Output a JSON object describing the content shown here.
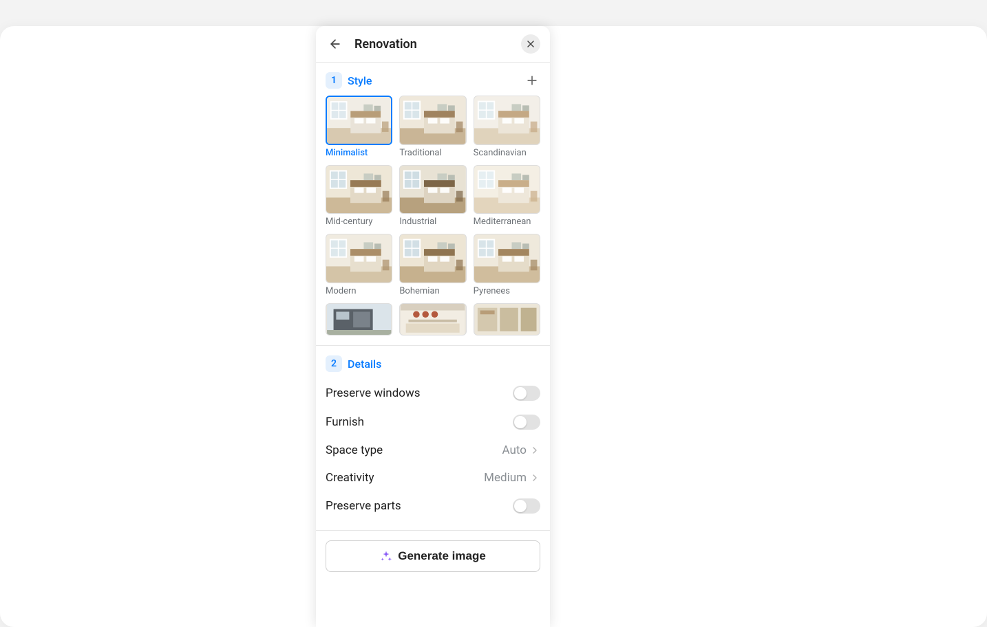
{
  "header": {
    "title": "Renovation"
  },
  "style": {
    "badge": "1",
    "title": "Style",
    "selected": 0,
    "items": [
      {
        "label": "Minimalist"
      },
      {
        "label": "Traditional"
      },
      {
        "label": "Scandinavian"
      },
      {
        "label": "Mid-century"
      },
      {
        "label": "Industrial"
      },
      {
        "label": "Mediterranean"
      },
      {
        "label": "Modern"
      },
      {
        "label": "Bohemian"
      },
      {
        "label": "Pyrenees"
      }
    ]
  },
  "details": {
    "badge": "2",
    "title": "Details",
    "rows": {
      "preserve_windows": {
        "label": "Preserve windows",
        "on": false
      },
      "furnish": {
        "label": "Furnish",
        "on": false
      },
      "space_type": {
        "label": "Space type",
        "value": "Auto"
      },
      "creativity": {
        "label": "Creativity",
        "value": "Medium"
      },
      "preserve_parts": {
        "label": "Preserve parts",
        "on": false
      }
    }
  },
  "generate": {
    "label": "Generate image"
  }
}
